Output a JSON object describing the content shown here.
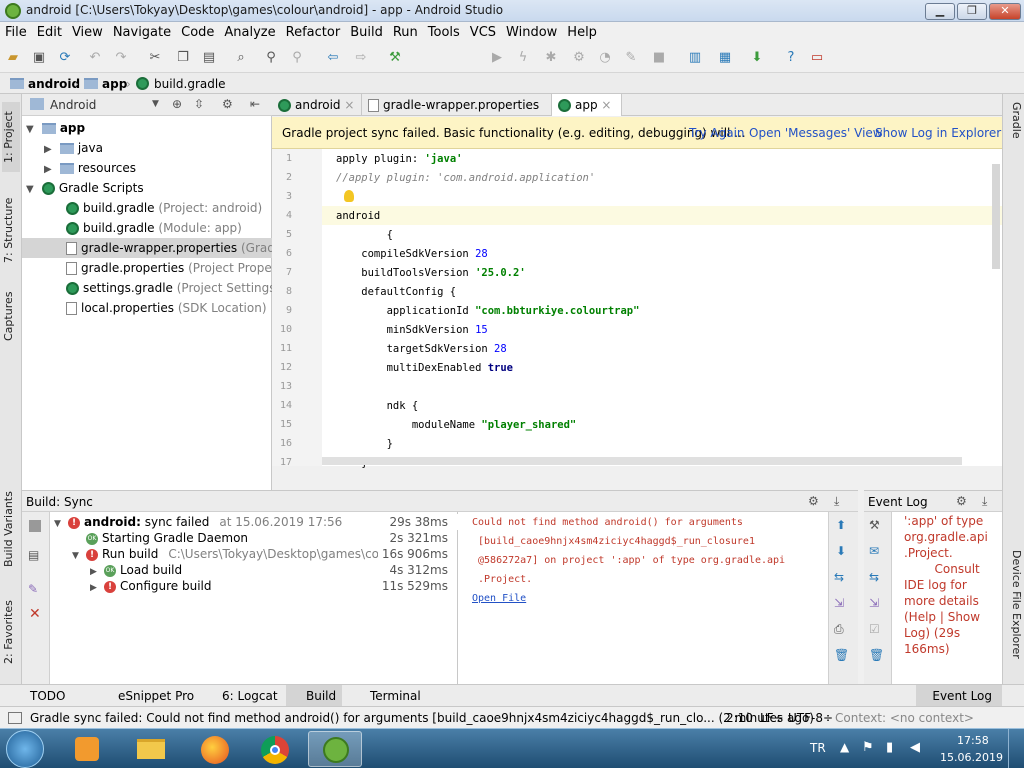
{
  "window": {
    "title": "android [C:\\Users\\Tokyay\\Desktop\\games\\colour\\android] - app - Android Studio"
  },
  "menu": [
    "File",
    "Edit",
    "View",
    "Navigate",
    "Code",
    "Analyze",
    "Refactor",
    "Build",
    "Run",
    "Tools",
    "VCS",
    "Window",
    "Help"
  ],
  "breadcrumb": [
    "android",
    "app",
    "build.gradle"
  ],
  "project_panel": {
    "view_mode": "Android",
    "items": [
      {
        "label": "app",
        "note": "",
        "depth": 0,
        "expanded": true
      },
      {
        "label": "java",
        "note": "",
        "depth": 1,
        "expanded": false
      },
      {
        "label": "resources",
        "note": "",
        "depth": 1,
        "expanded": false
      },
      {
        "label": "Gradle Scripts",
        "note": "",
        "depth": 0,
        "expanded": true
      },
      {
        "label": "build.gradle",
        "note": "(Project: android)",
        "depth": 1
      },
      {
        "label": "build.gradle",
        "note": "(Module: app)",
        "depth": 1
      },
      {
        "label": "gradle-wrapper.properties",
        "note": "(Gradle V",
        "depth": 1
      },
      {
        "label": "gradle.properties",
        "note": "(Project Properties",
        "depth": 1
      },
      {
        "label": "settings.gradle",
        "note": "(Project Settings)",
        "depth": 1
      },
      {
        "label": "local.properties",
        "note": "(SDK Location)",
        "depth": 1
      }
    ]
  },
  "editor_tabs": [
    "android",
    "gradle-wrapper.properties",
    "app"
  ],
  "banner": {
    "message": "Gradle project sync failed. Basic functionality (e.g. editing, debugging) will ...",
    "try_again": "Try Again",
    "open_messages": "Open 'Messages' View",
    "show_log": "Show Log in Explorer"
  },
  "code_lines": [
    {
      "n": "1",
      "parts": [
        [
          "apply ",
          ""
        ],
        [
          "plugin",
          ""
        ],
        [
          ": ",
          ""
        ],
        [
          "'java'",
          "str"
        ]
      ]
    },
    {
      "n": "2",
      "parts": [
        [
          "//apply plugin: 'com.android.application'",
          "cmt"
        ]
      ]
    },
    {
      "n": "3",
      "parts": []
    },
    {
      "n": "4",
      "parts": [
        [
          "android",
          ""
        ]
      ]
    },
    {
      "n": "5",
      "parts": [
        [
          "        {",
          ""
        ]
      ]
    },
    {
      "n": "6",
      "parts": [
        [
          "    compileSdkVersion ",
          ""
        ],
        [
          "28",
          "num"
        ]
      ]
    },
    {
      "n": "7",
      "parts": [
        [
          "    buildToolsVersion ",
          ""
        ],
        [
          "'25.0.2'",
          "str"
        ]
      ]
    },
    {
      "n": "8",
      "parts": [
        [
          "    defaultConfig {",
          ""
        ]
      ]
    },
    {
      "n": "9",
      "parts": [
        [
          "        applicationId ",
          ""
        ],
        [
          "\"com.bbturkiye.colourtrap\"",
          "str"
        ]
      ]
    },
    {
      "n": "10",
      "parts": [
        [
          "        minSdkVersion ",
          ""
        ],
        [
          "15",
          "num"
        ]
      ]
    },
    {
      "n": "11",
      "parts": [
        [
          "        targetSdkVersion ",
          ""
        ],
        [
          "28",
          "num"
        ]
      ]
    },
    {
      "n": "12",
      "parts": [
        [
          "        multiDexEnabled ",
          ""
        ],
        [
          "true",
          "kw"
        ]
      ]
    },
    {
      "n": "13",
      "parts": []
    },
    {
      "n": "14",
      "parts": [
        [
          "        ndk {",
          ""
        ]
      ]
    },
    {
      "n": "15",
      "parts": [
        [
          "            moduleName ",
          ""
        ],
        [
          "\"player_shared\"",
          "str"
        ]
      ]
    },
    {
      "n": "16",
      "parts": [
        [
          "        }",
          ""
        ]
      ]
    },
    {
      "n": "17",
      "parts": [
        [
          "    }",
          ""
        ]
      ]
    }
  ],
  "build": {
    "header": "Build: Sync",
    "rows": [
      {
        "label": "android:",
        "rest": " sync failed",
        "extra": "at 15.06.2019 17:56",
        "time": "29s 38ms",
        "icon": "err",
        "indent": 0,
        "arrow": "▼"
      },
      {
        "label": "Starting Gradle Daemon",
        "rest": "",
        "extra": "",
        "time": "2s 321ms",
        "icon": "ok",
        "indent": 1,
        "arrow": ""
      },
      {
        "label": "Run build",
        "rest": "",
        "extra": "C:\\Users\\Tokyay\\Desktop\\games\\colour",
        "time": "16s 906ms",
        "icon": "err",
        "indent": 1,
        "arrow": "▼"
      },
      {
        "label": "Load build",
        "rest": "",
        "extra": "",
        "time": "4s 312ms",
        "icon": "ok",
        "indent": 2,
        "arrow": "▶"
      },
      {
        "label": "Configure build",
        "rest": "",
        "extra": "",
        "time": "11s 529ms",
        "icon": "err",
        "indent": 2,
        "arrow": "▶"
      }
    ],
    "output": [
      "Could not find method android() for arguments",
      " [build_caoe9hnjx4sm4ziciyc4haggd$_run_closure1",
      " @586272a7] on project ':app' of type org.gradle.api",
      " .Project."
    ],
    "open_file": "Open File"
  },
  "event_log": {
    "header": "Event Log",
    "lines": [
      "':app' of type",
      "org.gradle.api",
      ".Project.",
      "        Consult",
      "IDE log for",
      "more details",
      "(Help | Show",
      "Log) (29s",
      "166ms)"
    ]
  },
  "bottom_tabs": [
    "TODO",
    "eSnippet Pro",
    "6: Logcat",
    "Build",
    "Terminal"
  ],
  "event_log_tab": "Event Log",
  "status": {
    "message": "Gradle sync failed: Could not find method android() for arguments [build_caoe9hnjx4sm4ziciyc4haggd$_run_clo... (2 minutes ago)",
    "position": "2:10",
    "line_sep": "LF÷",
    "encoding": "UTF-8÷",
    "context": "Context: <no context>"
  },
  "side_tabs_left": [
    "1: Project",
    "7: Structure",
    "Captures",
    "Build Variants",
    "2: Favorites"
  ],
  "side_tabs_right": [
    "Gradle",
    "Device File Explorer"
  ],
  "taskbar": {
    "lang": "TR",
    "time": "17:58",
    "date": "15.06.2019"
  }
}
